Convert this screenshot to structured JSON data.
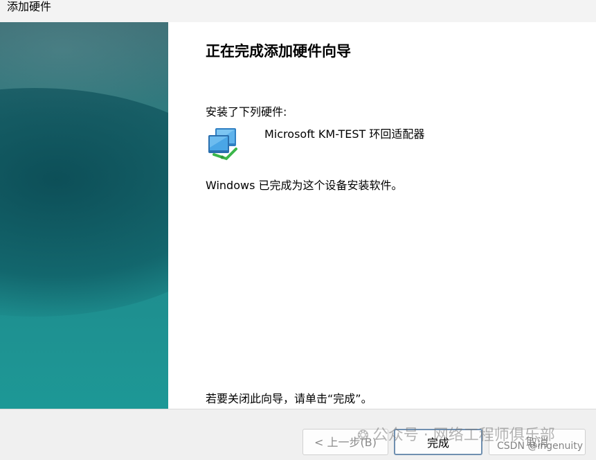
{
  "window": {
    "title": "添加硬件"
  },
  "wizard": {
    "heading": "正在完成添加硬件向导",
    "installed_label": "安装了下列硬件:",
    "hardware_name": "Microsoft KM-TEST 环回适配器",
    "hardware_icon": "network-adapter-icon",
    "done_message": "Windows 已完成为这个设备安装软件。",
    "close_hint": "若要关闭此向导，请单击“完成”。"
  },
  "buttons": {
    "back_label": "< 上一步(B)",
    "finish_label": "完成",
    "cancel_label": "取消"
  },
  "watermark": {
    "text": "公众号 · 网络工程师俱乐部",
    "icon": "wechat-icon",
    "csdn": "CSDN @ingenuity"
  },
  "colors": {
    "side_panel_top": "#3f6f76",
    "side_panel_bottom": "#1d9896",
    "footer_bg": "#f0f0f0",
    "finish_border": "#6f8fb0"
  }
}
